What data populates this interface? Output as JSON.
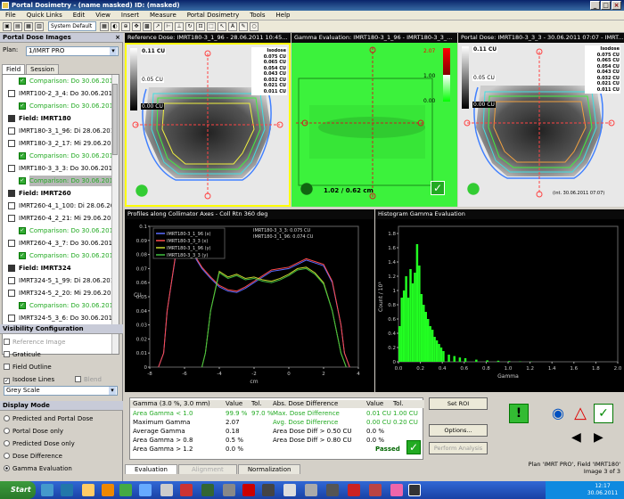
{
  "window": {
    "title": "Portal Dosimetry - (name masked) ID: (masked)",
    "min": "_",
    "max": "□",
    "close": "×"
  },
  "menu": [
    "File",
    "Quick Links",
    "Edit",
    "View",
    "Insert",
    "Measure",
    "Portal Dosimetry",
    "Tools",
    "Help"
  ],
  "toolbar": {
    "layout_select": "System Default"
  },
  "left": {
    "header": "Portal Dose Images",
    "plan_label": "Plan:",
    "plan_value": "1/IMRT PRO",
    "tabs": [
      "Field",
      "Session"
    ],
    "tree": [
      {
        "t": "c",
        "x": 30,
        "text": "Comparison: Do 30.06.2011"
      },
      {
        "t": "i",
        "x": 18,
        "text": "IMRT100-2_3_4: Do 30.06.201"
      },
      {
        "t": "c",
        "x": 30,
        "text": "Comparison: Do 30.06.2011"
      },
      {
        "t": "f",
        "x": 18,
        "text": "Field: IMRT180"
      },
      {
        "t": "i",
        "x": 18,
        "text": "IMRT180-3_1_96: Di 28.06.201"
      },
      {
        "t": "i",
        "x": 18,
        "text": "IMRT180-3_2_17: Mi 29.06.201"
      },
      {
        "t": "c",
        "x": 30,
        "text": "Comparison: Do 30.06.2011"
      },
      {
        "t": "i",
        "x": 18,
        "text": "IMRT180-3_3_3: Do 30.06.201"
      },
      {
        "t": "cs",
        "x": 30,
        "text": "Comparison: Do 30.06.2011"
      },
      {
        "t": "f",
        "x": 18,
        "text": "Field: IMRT260"
      },
      {
        "t": "i",
        "x": 18,
        "text": "IMRT260-4_1_100: Di 28.06.201"
      },
      {
        "t": "i",
        "x": 18,
        "text": "IMRT260-4_2_21: Mi 29.06.201"
      },
      {
        "t": "c",
        "x": 30,
        "text": "Comparison: Do 30.06.2011"
      },
      {
        "t": "i",
        "x": 18,
        "text": "IMRT260-4_3_7: Do 30.06.201"
      },
      {
        "t": "c",
        "x": 30,
        "text": "Comparison: Do 30.06.2011"
      },
      {
        "t": "f",
        "x": 18,
        "text": "Field: IMRT324"
      },
      {
        "t": "i",
        "x": 18,
        "text": "IMRT324-5_1_99: Di 28.06.201"
      },
      {
        "t": "i",
        "x": 18,
        "text": "IMRT324-5_2_20: Mi 29.06.201"
      },
      {
        "t": "c",
        "x": 30,
        "text": "Comparison: Do 30.06.2011"
      },
      {
        "t": "i",
        "x": 18,
        "text": "IMRT324-5_3_6: Do 30.06.201"
      },
      {
        "t": "c",
        "x": 30,
        "text": "Comparison: Do 30.06.2011"
      }
    ],
    "vis_header": "Visibility Configuration",
    "vis": {
      "reference_image": "Reference Image",
      "graticule": "Graticule",
      "field_outline": "Field Outline",
      "isodose": "Isodose Lines",
      "blend": "Blend",
      "colormap": "Grey Scale"
    },
    "mode_header": "Display Mode",
    "modes": [
      "Predicted and Portal Dose",
      "Portal Dose only",
      "Predicted Dose only",
      "Dose Difference",
      "Gamma Evaluation"
    ],
    "mode_selected": 4
  },
  "panels": {
    "ref_title": "Reference Dose: IMRT180-3_1_96 - 28.06.2011 10:45...",
    "gamma_title": "Gamma Evaluation: IMRT180-3_1_96 - IMRT180-3_3_...",
    "portal_title": "Portal Dose: IMRT180-3_3_3 - 30.06.2011 07:07 - IMRT...",
    "ref_top": "0.11 CU",
    "ref_mid": "0.05 CU",
    "ref_bottom": "0.00 CU",
    "portal_top": "0.11 CU",
    "portal_mid": "0.05 CU",
    "portal_bottom": "0.00 CU",
    "gamma_top": "2.07",
    "gamma_mid": "1.00",
    "gamma_bottom": "0.00",
    "gamma_readout": "1.02 / 0.62 cm",
    "portal_readout": "(int. 30.06.2011 07:07)",
    "isodose_header": "Isodose",
    "isodose": [
      "0.075 CU",
      "0.065 CU",
      "0.054 CU",
      "0.043 CU",
      "0.032 CU",
      "0.021 CU",
      "0.011 CU"
    ],
    "isodose_colors": [
      "#ffffff",
      "#ffffff",
      "#f0f040",
      "#40f040",
      "#40e0e0",
      "#4080ff",
      "#ffffff"
    ]
  },
  "profile": {
    "title": "Profiles along Collimator Axes - Coll Rtn 360 deg",
    "legend": [
      "IMRT180-3_1_96 (x)",
      "IMRT180-3_3_3 (x)",
      "IMRT180-3_1_96 (y)",
      "IMRT180-3_3_3 (y)"
    ],
    "legend_colors": [
      "#5a6cff",
      "#ff4a4a",
      "#c8d830",
      "#40c040"
    ],
    "readout1": "IMRT180-3_3_3: 0.075 CU",
    "readout2": "IMRT180-3_1_96: 0.074 CU",
    "ylabel": "CU",
    "xlabel": "cm",
    "yticks": [
      "0.1",
      "0.09",
      "0.08",
      "0.07",
      "0.06",
      "0.05",
      "0.04",
      "0.03",
      "0.02",
      "0.01",
      "0"
    ],
    "xticks": [
      "-8",
      "-6",
      "-4",
      "-2",
      "0",
      "2",
      "4"
    ]
  },
  "histogram": {
    "title": "Histogram Gamma Evaluation",
    "ylabel": "Count / 10³",
    "xlabel": "Gamma",
    "yticks": [
      "1.8",
      "1.6",
      "1.4",
      "1.2",
      "1",
      "0.8",
      "0.6",
      "0.4",
      "0.2",
      "0"
    ],
    "xticks": [
      "0.0",
      "0.2",
      "0.4",
      "0.6",
      "0.8",
      "1.0",
      "1.2",
      "1.4",
      "1.6",
      "1.8",
      "2.0"
    ]
  },
  "chart_data": [
    {
      "type": "line",
      "title": "Profiles along Collimator Axes - Coll Rtn 360 deg",
      "xlabel": "cm",
      "ylabel": "CU",
      "xlim": [
        -8,
        4
      ],
      "ylim": [
        0,
        0.1
      ],
      "series": [
        {
          "name": "IMRT180-3_1_96 (x)",
          "x": [
            -7.5,
            -7.2,
            -7,
            -6.5,
            -6,
            -5.5,
            -5,
            -4.5,
            -4,
            -3.5,
            -3,
            -2.5,
            -2,
            -1.5,
            -1,
            -0.5,
            0,
            0.5,
            1,
            1.5,
            2,
            2.5,
            3,
            3.2,
            3.5
          ],
          "values": [
            0,
            0.01,
            0.04,
            0.08,
            0.088,
            0.08,
            0.07,
            0.063,
            0.057,
            0.054,
            0.053,
            0.056,
            0.06,
            0.064,
            0.068,
            0.069,
            0.07,
            0.073,
            0.076,
            0.074,
            0.072,
            0.06,
            0.03,
            0.01,
            0
          ]
        },
        {
          "name": "IMRT180-3_3_3 (x)",
          "x": [
            -7.5,
            -7.2,
            -7,
            -6.5,
            -6,
            -5.5,
            -5,
            -4.5,
            -4,
            -3.5,
            -3,
            -2.5,
            -2,
            -1.5,
            -1,
            -0.5,
            0,
            0.5,
            1,
            1.5,
            2,
            2.5,
            3,
            3.2,
            3.5
          ],
          "values": [
            0,
            0.01,
            0.04,
            0.081,
            0.089,
            0.081,
            0.071,
            0.064,
            0.058,
            0.055,
            0.054,
            0.057,
            0.061,
            0.065,
            0.069,
            0.07,
            0.071,
            0.074,
            0.077,
            0.075,
            0.073,
            0.061,
            0.03,
            0.01,
            0
          ]
        },
        {
          "name": "IMRT180-3_1_96 (y)",
          "x": [
            -5,
            -4.8,
            -4.5,
            -4,
            -3.5,
            -3,
            -2.5,
            -2,
            -1.5,
            -1,
            -0.5,
            0,
            0.5,
            1,
            1.5,
            2,
            2.5,
            3,
            3.3
          ],
          "values": [
            0,
            0.01,
            0.04,
            0.068,
            0.064,
            0.066,
            0.063,
            0.064,
            0.062,
            0.061,
            0.063,
            0.066,
            0.07,
            0.071,
            0.067,
            0.06,
            0.04,
            0.01,
            0
          ]
        },
        {
          "name": "IMRT180-3_3_3 (y)",
          "x": [
            -5,
            -4.8,
            -4.5,
            -4,
            -3.5,
            -3,
            -2.5,
            -2,
            -1.5,
            -1,
            -0.5,
            0,
            0.5,
            1,
            1.5,
            2,
            2.5,
            3,
            3.3
          ],
          "values": [
            0,
            0.01,
            0.04,
            0.067,
            0.063,
            0.065,
            0.062,
            0.063,
            0.061,
            0.06,
            0.062,
            0.065,
            0.069,
            0.07,
            0.066,
            0.059,
            0.04,
            0.01,
            0
          ]
        }
      ]
    },
    {
      "type": "bar",
      "title": "Histogram Gamma Evaluation",
      "xlabel": "Gamma",
      "ylabel": "Count / 10³",
      "xlim": [
        0,
        2
      ],
      "ylim": [
        0,
        1.9
      ],
      "x": [
        0.0,
        0.02,
        0.04,
        0.06,
        0.08,
        0.1,
        0.12,
        0.14,
        0.16,
        0.18,
        0.2,
        0.22,
        0.24,
        0.26,
        0.28,
        0.3,
        0.32,
        0.34,
        0.36,
        0.38,
        0.4,
        0.45,
        0.5,
        0.55,
        0.6,
        0.7,
        0.8,
        0.9,
        1.0,
        1.1,
        1.2
      ],
      "values": [
        0.5,
        0.9,
        1.0,
        1.2,
        0.9,
        1.3,
        1.1,
        1.25,
        1.65,
        1.35,
        0.95,
        0.8,
        0.7,
        0.6,
        0.5,
        0.45,
        0.35,
        0.3,
        0.25,
        0.2,
        0.15,
        0.1,
        0.08,
        0.06,
        0.05,
        0.03,
        0.02,
        0.015,
        0.01,
        0.005,
        0.003
      ]
    }
  ],
  "stats": {
    "headers": [
      "Gamma (3.0 %, 3.0 mm)",
      "Value",
      "Tol.",
      "Abs. Dose Difference",
      "Value",
      "Tol."
    ],
    "rows": [
      [
        "Area Gamma < 1.0",
        "99.9 %",
        "97.0 %",
        "Max. Dose Difference",
        "0.01 CU",
        "1.00 CU"
      ],
      [
        "Maximum Gamma",
        "2.07",
        "",
        "Avg. Dose Difference",
        "0.00 CU",
        "0.20 CU"
      ],
      [
        "Average Gamma",
        "0.18",
        "",
        "Area Dose Diff > 0.50 CU",
        "0.0 %",
        ""
      ],
      [
        "Area Gamma > 0.8",
        "0.5 %",
        "",
        "Area Dose Diff > 0.80 CU",
        "0.0 %",
        ""
      ],
      [
        "Area Gamma > 1.2",
        "0.0 %",
        "",
        "",
        "",
        ""
      ]
    ],
    "passed": "Passed"
  },
  "buttons": {
    "set_roi": "Set ROI",
    "options": "Options...",
    "perform": "Perform Analysis"
  },
  "bottom_tabs": [
    "Evaluation",
    "Alignment",
    "Normalization"
  ],
  "status": {
    "line1": "Plan 'IMRT PRO', Field 'IMRT180'",
    "line2": "Image 3 of 3"
  },
  "taskbar": {
    "start": "Start",
    "time": "12:17",
    "date": "30.06.2011"
  }
}
